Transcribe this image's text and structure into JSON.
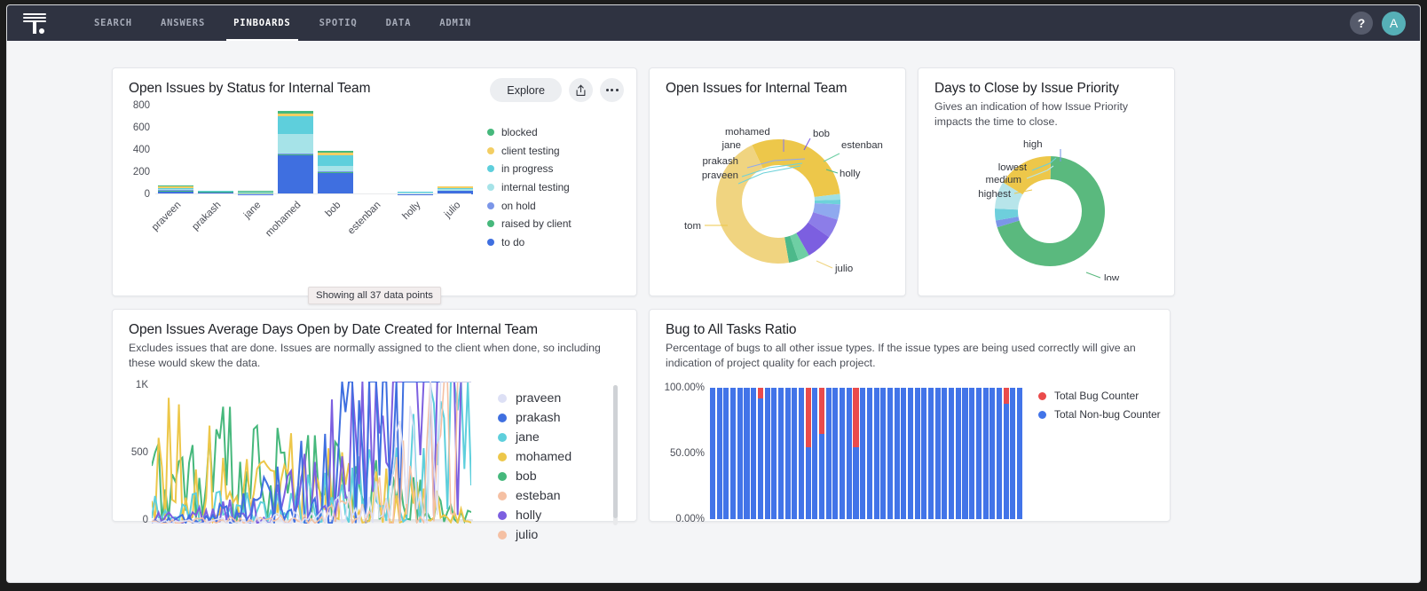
{
  "nav": {
    "logo_name": "thoughtspot-logo",
    "items": [
      {
        "label": "SEARCH",
        "active": false
      },
      {
        "label": "ANSWERS",
        "active": false
      },
      {
        "label": "PINBOARDS",
        "active": true
      },
      {
        "label": "SPOTIQ",
        "active": false
      },
      {
        "label": "DATA",
        "active": false
      },
      {
        "label": "ADMIN",
        "active": false
      }
    ],
    "help_label": "?",
    "avatar_label": "A"
  },
  "cards": {
    "bar": {
      "title": "Open Issues by Status for Internal Team",
      "explore_label": "Explore",
      "tooltip": "Showing all 37 data points"
    },
    "donut1": {
      "title": "Open Issues for Internal Team"
    },
    "donut2": {
      "title": "Days to Close by Issue Priority",
      "subtitle": "Gives an indication of how Issue Priority impacts the time to close."
    },
    "line": {
      "title": "Open Issues Average Days Open by Date Created for Internal Team",
      "subtitle": "Excludes issues that are done. Issues are normally assigned to the client when done, so including these would skew the data."
    },
    "ratio": {
      "title": "Bug to All Tasks Ratio",
      "subtitle": "Percentage of bugs to all other issue types. If the issue types are being used correctly will give an indication of project quality for each project."
    }
  },
  "chart_data": [
    {
      "id": "open-issues-by-status",
      "type": "bar",
      "stacked": true,
      "title": "Open Issues by Status for Internal Team",
      "xlabel": "",
      "ylabel": "",
      "ylim": [
        0,
        800
      ],
      "yticks": [
        0,
        200,
        400,
        600,
        800
      ],
      "grid": false,
      "legend_position": "right",
      "categories": [
        "praveen",
        "prakash",
        "jane",
        "mohamed",
        "bob",
        "estenban",
        "holly",
        "julio"
      ],
      "series": [
        {
          "name": "to do",
          "color": "#3f6fe0",
          "values": [
            28,
            18,
            4,
            350,
            196,
            0,
            2,
            30
          ]
        },
        {
          "name": "raised by client",
          "color": "#46b87c",
          "values": [
            6,
            3,
            16,
            14,
            8,
            0,
            1,
            4
          ]
        },
        {
          "name": "on hold",
          "color": "#7b96e8",
          "values": [
            3,
            1,
            0,
            8,
            4,
            0,
            0,
            2
          ]
        },
        {
          "name": "internal testing",
          "color": "#a6e3e8",
          "values": [
            12,
            4,
            3,
            170,
            52,
            0,
            14,
            14
          ]
        },
        {
          "name": "in progress",
          "color": "#5ecfdc",
          "values": [
            10,
            3,
            2,
            160,
            90,
            0,
            5,
            9
          ]
        },
        {
          "name": "client testing",
          "color": "#f3ce63",
          "values": [
            14,
            2,
            3,
            30,
            28,
            0,
            2,
            10
          ]
        },
        {
          "name": "blocked",
          "color": "#46b87c",
          "values": [
            5,
            1,
            1,
            18,
            12,
            0,
            1,
            3
          ]
        }
      ]
    },
    {
      "id": "open-issues-donut",
      "type": "pie",
      "donut": true,
      "title": "Open Issues for Internal Team",
      "labels": [
        "tom",
        "praveen",
        "prakash",
        "jane",
        "mohamed",
        "bob",
        "estenban",
        "holly",
        "julio"
      ],
      "values": [
        30.0,
        1.5,
        1.2,
        4.0,
        5.0,
        7.0,
        3.0,
        2.5,
        45.8
      ],
      "colors": [
        "#edc74a",
        "#9fe0e5",
        "#6ed2da",
        "#8fa9ef",
        "#8c7de8",
        "#7c5fe0",
        "#6ecfa4",
        "#4cb98a",
        "#f0d480"
      ]
    },
    {
      "id": "days-to-close-by-priority",
      "type": "pie",
      "donut": true,
      "title": "Days to Close by Issue Priority",
      "labels": [
        "low",
        "high",
        "lowest",
        "medium",
        "highest"
      ],
      "values": [
        70.0,
        2.0,
        3.5,
        8.0,
        16.5
      ],
      "colors": [
        "#5ab97e",
        "#7b96e8",
        "#6ecfdc",
        "#b7e5ea",
        "#edc74a"
      ]
    },
    {
      "id": "avg-days-open-by-date",
      "type": "line",
      "title": "Open Issues Average Days Open by Date Created for Internal Team",
      "ylim": [
        0,
        1000
      ],
      "yticks": [
        0,
        500,
        1000
      ],
      "ytick_labels": [
        "0",
        "500",
        "1K"
      ],
      "xlabel": "",
      "grid": false,
      "legend_position": "right",
      "series": [
        {
          "name": "praveen",
          "color": "#dde0f5"
        },
        {
          "name": "prakash",
          "color": "#3f6fe0"
        },
        {
          "name": "jane",
          "color": "#5ecfdc"
        },
        {
          "name": "mohamed",
          "color": "#edc74a"
        },
        {
          "name": "bob",
          "color": "#46b87c"
        },
        {
          "name": "esteban",
          "color": "#f5c0a3"
        },
        {
          "name": "holly",
          "color": "#7c5fe0"
        },
        {
          "name": "julio",
          "color": "#f5c0a3"
        }
      ]
    },
    {
      "id": "bug-to-all-tasks-ratio",
      "type": "bar",
      "stacked": true,
      "normalized": true,
      "title": "Bug to All Tasks Ratio",
      "ylim": [
        0,
        100
      ],
      "ytick_labels": [
        "0.00%",
        "50.00%",
        "100.00%"
      ],
      "yticks": [
        0,
        50,
        100
      ],
      "legend_position": "right",
      "series": [
        {
          "name": "Total Bug Counter",
          "color": "#ea4b4b"
        },
        {
          "name": "Total Non-bug Counter",
          "color": "#4274e8"
        }
      ],
      "bug_pct": [
        0,
        0,
        0,
        0,
        0,
        0,
        0,
        8,
        0,
        0,
        0,
        0,
        0,
        0,
        45,
        0,
        35,
        0,
        0,
        0,
        0,
        45,
        0,
        0,
        0,
        0,
        0,
        0,
        0,
        0,
        0,
        0,
        0,
        0,
        0,
        0,
        0,
        0,
        0,
        0,
        0,
        0,
        0,
        12,
        0,
        0
      ]
    }
  ]
}
